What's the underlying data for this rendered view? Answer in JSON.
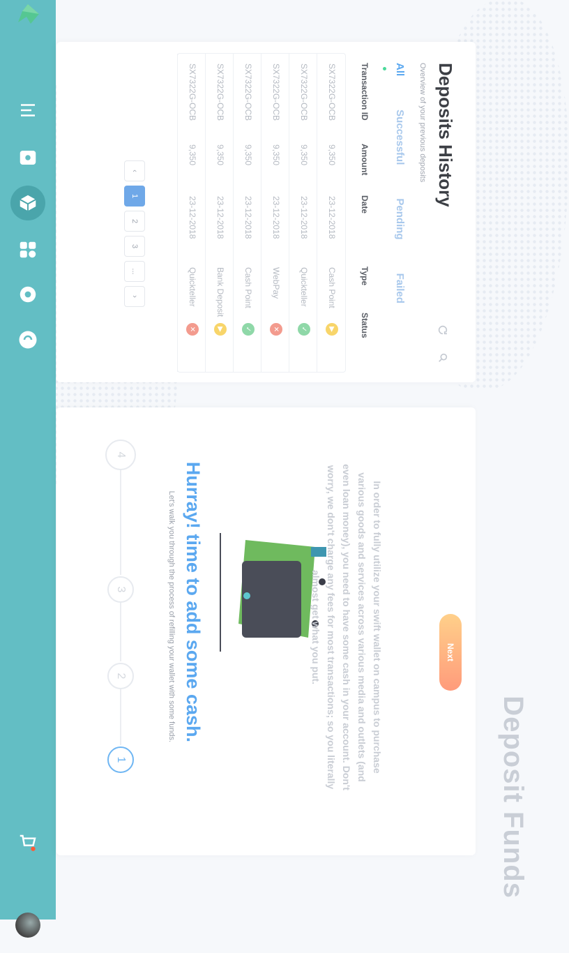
{
  "app": {
    "page_title": "Deposit Funds",
    "toolbar": {
      "items": [
        {
          "name": "cart-icon"
        },
        {
          "name": "menu-icon"
        },
        {
          "name": "wallet-icon"
        },
        {
          "name": "cube-icon"
        },
        {
          "name": "grid-icon"
        },
        {
          "name": "gear-icon"
        },
        {
          "name": "chat-icon"
        },
        {
          "name": "logout-icon"
        }
      ],
      "active": "cube-icon",
      "color": "#63bec4"
    }
  },
  "wizard": {
    "steps": [
      "1",
      "2",
      "3",
      "4"
    ],
    "active_step": "1",
    "title": "Hurray! time to add some cash.",
    "subtitle": "Let's walk you through the process of refilling your wallet with some funds.",
    "description": "In order to fully utilize your swift wallet on campus to purchase various goods and services across various media and outlets (and even loan money), you need to have some cash in your account. Don't worry, we don't charge any fees for most transactions; so you literally almost get what you put.",
    "next_label": "Next"
  },
  "history": {
    "title": "Deposits History",
    "subtitle": "Overview of your previous deposits",
    "tabs": [
      "All",
      "Successful",
      "Pending",
      "Failed"
    ],
    "active_tab": "All",
    "columns": [
      "Transaction ID",
      "Amount",
      "Date",
      "Type",
      "Status"
    ],
    "rows": [
      {
        "id": "SX7322G-OCB",
        "amount": "9,350",
        "date": "23-12-2018",
        "type": "Cash Point",
        "status": "pending"
      },
      {
        "id": "SX7322G-OCB",
        "amount": "9,350",
        "date": "23-12-2018",
        "type": "Quickteller",
        "status": "success"
      },
      {
        "id": "SX7322G-OCB",
        "amount": "9,350",
        "date": "23-12-2018",
        "type": "WebPay",
        "status": "failed"
      },
      {
        "id": "SX7322G-OCB",
        "amount": "9,350",
        "date": "23-12-2018",
        "type": "Cash Point",
        "status": "success"
      },
      {
        "id": "SX7322G-OCB",
        "amount": "9,350",
        "date": "23-12-2018",
        "type": "Bank Deposit",
        "status": "pending"
      },
      {
        "id": "SX7322G-OCB",
        "amount": "9,350",
        "date": "23-12-2018",
        "type": "Quickteller",
        "status": "failed"
      }
    ],
    "pagination": [
      "1",
      "2",
      "3",
      "..."
    ],
    "active_page": "1",
    "status_colors": {
      "success": "#8fd8a8",
      "pending": "#f8d56a",
      "failed": "#f39b8e"
    }
  }
}
